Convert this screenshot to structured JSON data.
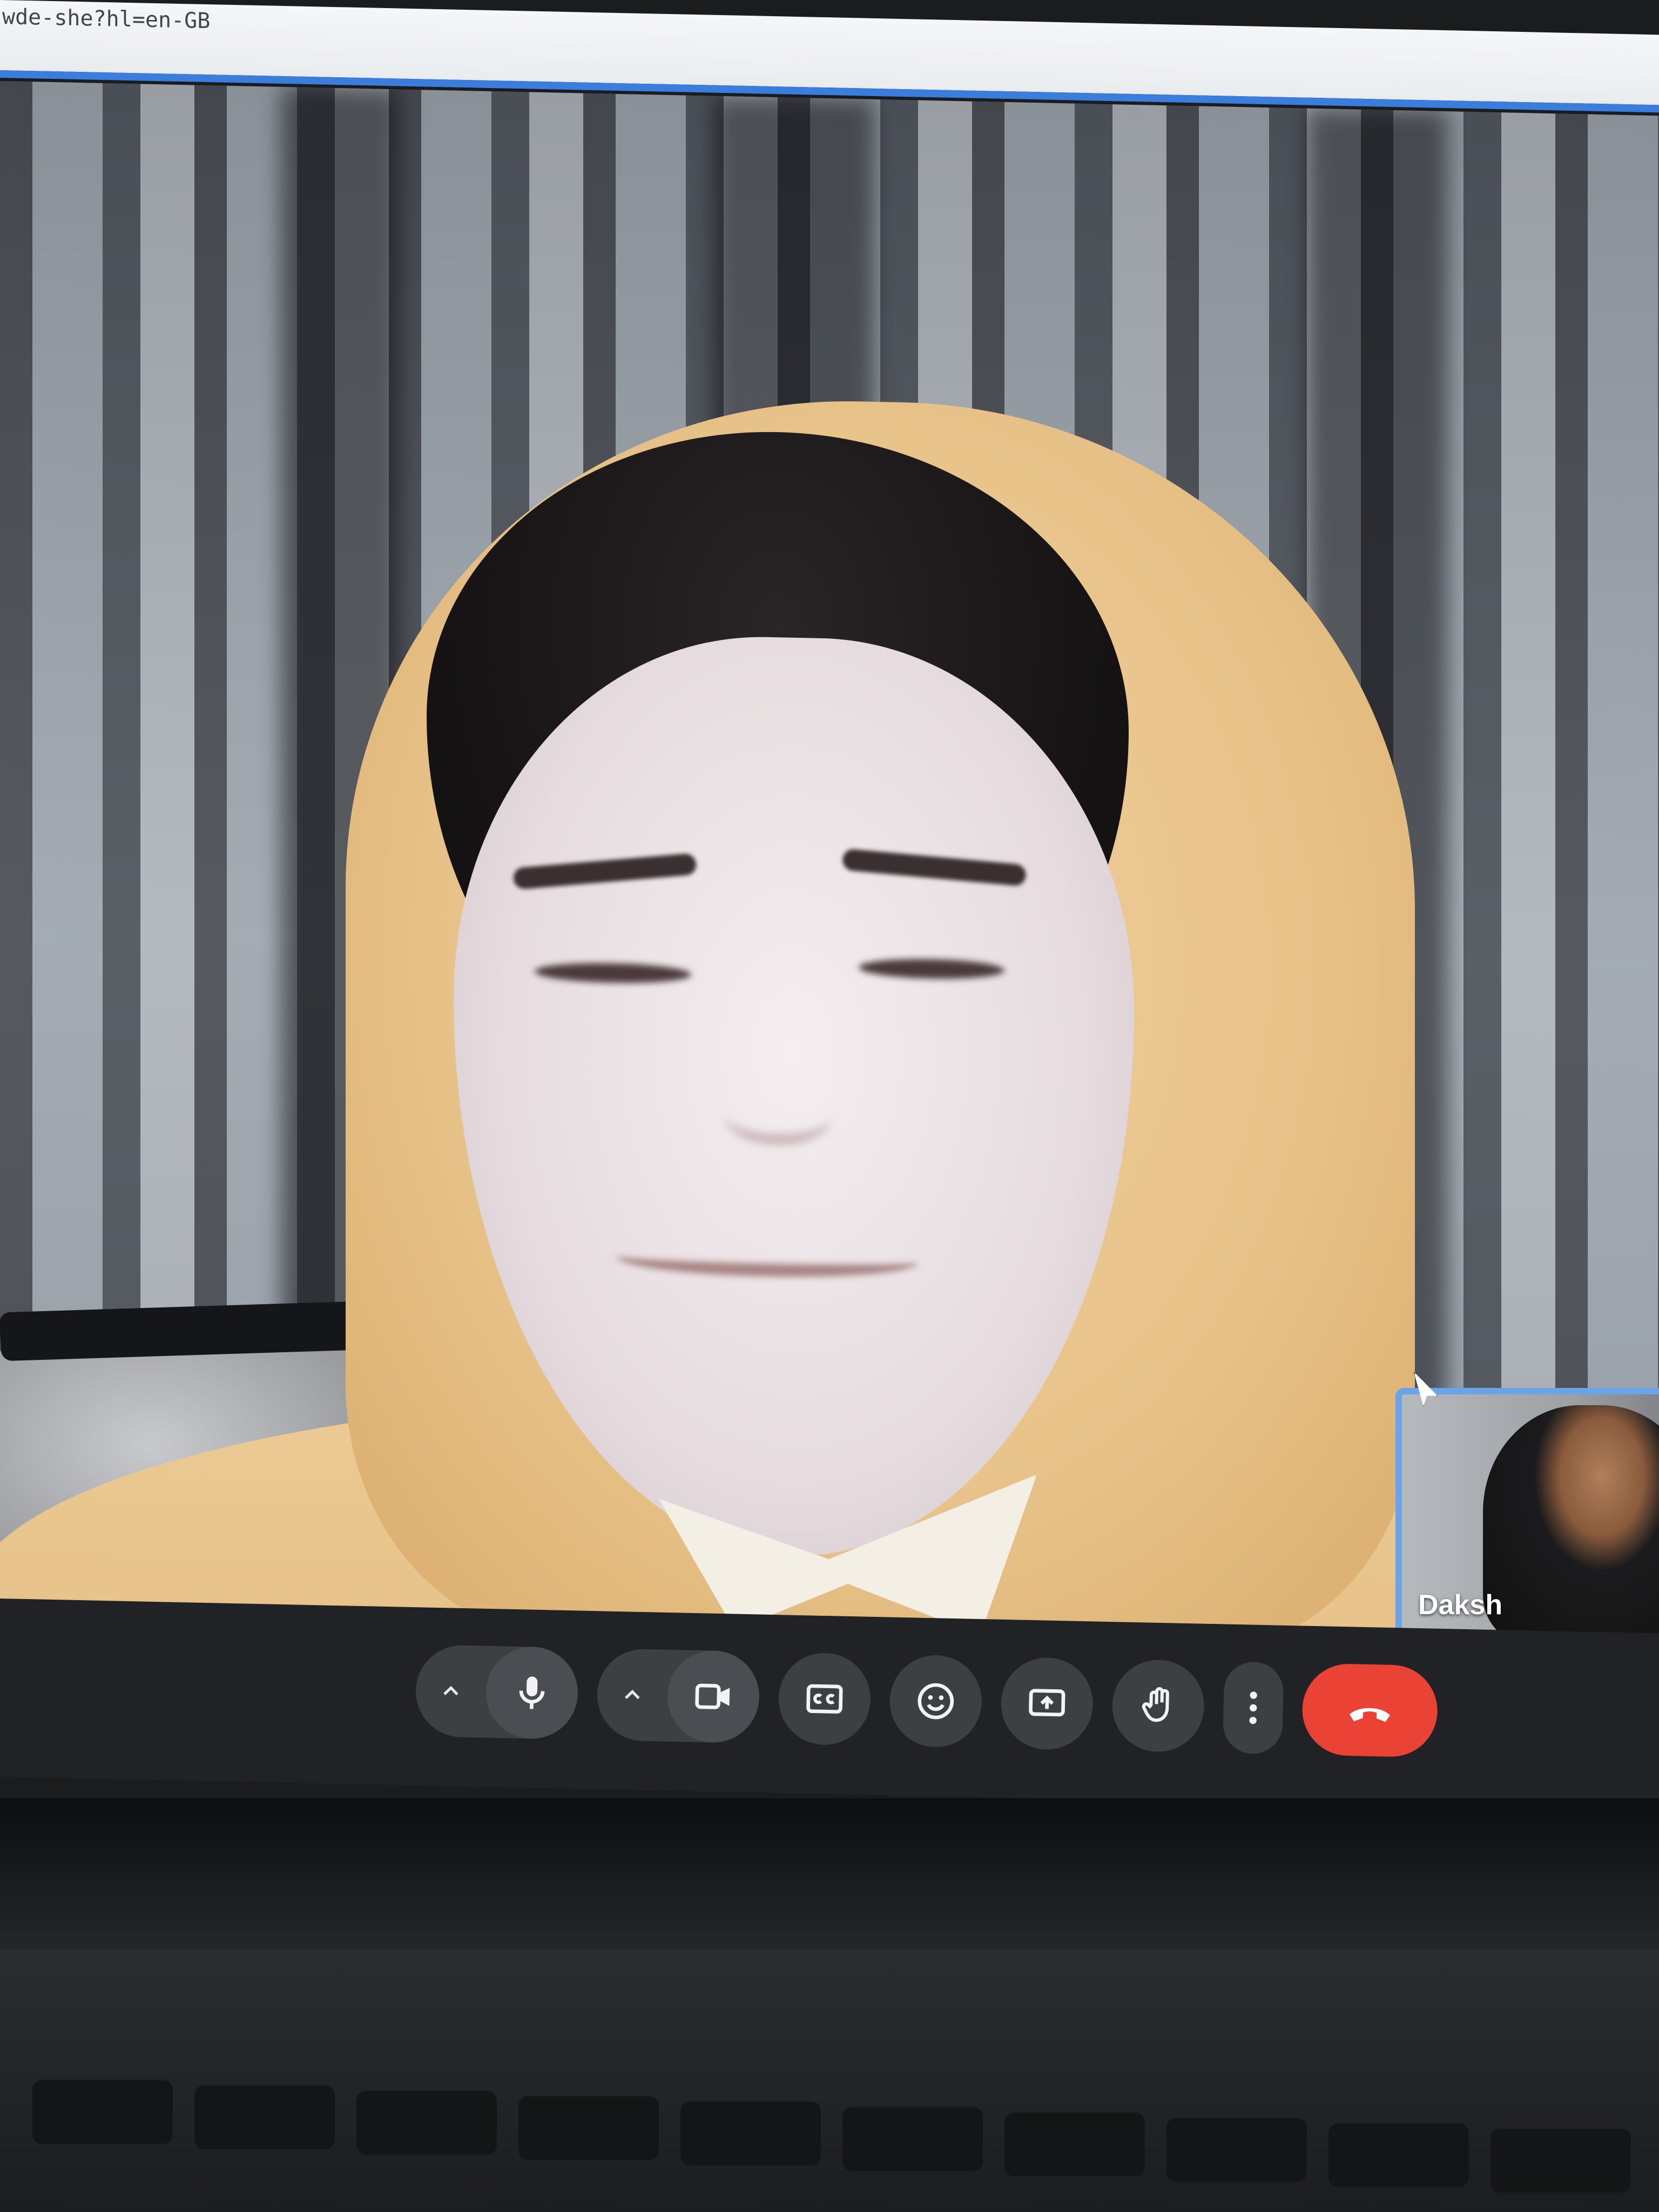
{
  "browser": {
    "url_fragment": "wde-she?hl=en-GB"
  },
  "call": {
    "self_view_name": "Daksh"
  },
  "controls": {
    "icons": [
      "chevron-up-icon",
      "microphone-icon",
      "chevron-up-icon",
      "camera-icon",
      "captions-icon",
      "emoji-icon",
      "present-screen-icon",
      "raise-hand-icon",
      "more-vert-icon",
      "hang-up-icon"
    ],
    "colors": {
      "bar": "#202226",
      "button": "#3c4043",
      "hangup": "#ea4335",
      "selfview_border": "#6aa4e6"
    }
  }
}
